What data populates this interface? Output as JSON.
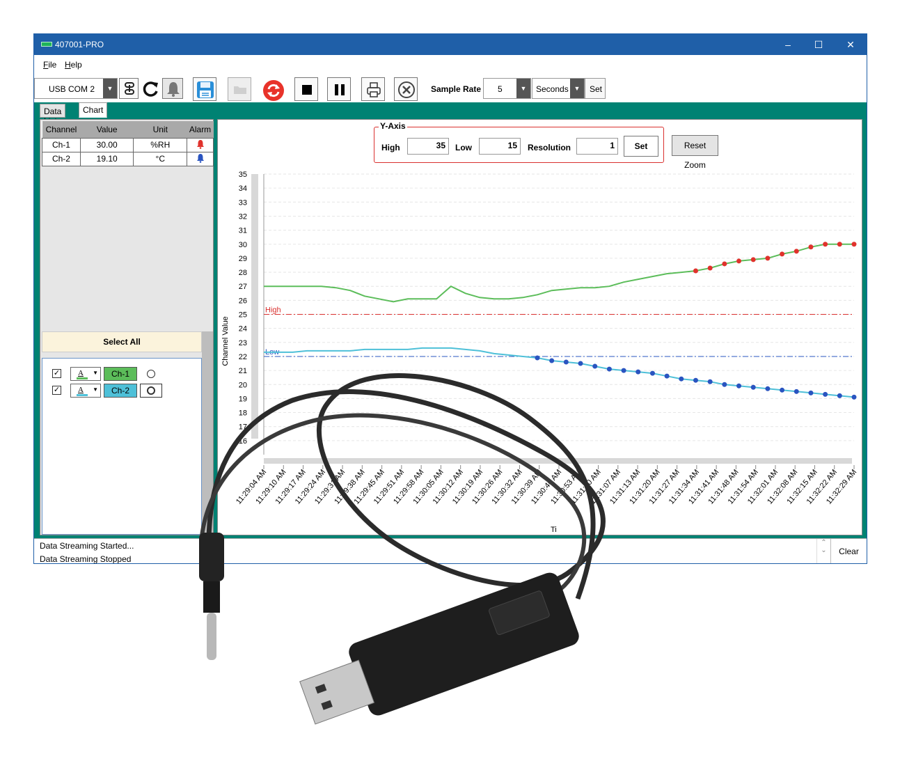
{
  "window": {
    "title": "407001-PRO",
    "minimize": "–",
    "maximize": "☐",
    "close": "✕"
  },
  "menu": {
    "file": "File",
    "help": "Help"
  },
  "toolbar": {
    "port": "USB COM 2",
    "sample_rate_label": "Sample Rate",
    "sample_rate_value": "5",
    "sample_rate_unit": "Seconds",
    "set_label": "Set"
  },
  "tabs": {
    "data_list": "Data List",
    "chart": "Chart"
  },
  "grid": {
    "headers": [
      "Channel",
      "Value",
      "Unit",
      "Alarm"
    ],
    "rows": [
      {
        "channel": "Ch-1",
        "value": "30.00",
        "unit": "%RH",
        "alarm_color": "#e0322c"
      },
      {
        "channel": "Ch-2",
        "value": "19.10",
        "unit": "°C",
        "alarm_color": "#2a54c0"
      }
    ]
  },
  "channels": {
    "select_all": "Select All",
    "items": [
      {
        "name": "Ch-1",
        "color": "#5cbd5a",
        "checked": true,
        "color_btn": "A"
      },
      {
        "name": "Ch-2",
        "color": "#4ec0d8",
        "checked": true,
        "color_btn": "A"
      }
    ]
  },
  "y_axis": {
    "legend": "Y-Axis",
    "high_label": "High",
    "high_value": "35",
    "low_label": "Low",
    "low_value": "15",
    "resolution_label": "Resolution",
    "resolution_value": "1",
    "set_label": "Set",
    "reset_zoom": "Reset Zoom"
  },
  "chart_data": {
    "type": "line",
    "ylabel": "Channel Value",
    "xlabel": "Ti",
    "ylim": [
      15,
      35
    ],
    "y_ticks": [
      16,
      17,
      18,
      19,
      20,
      21,
      22,
      23,
      24,
      25,
      26,
      27,
      28,
      29,
      30,
      31,
      32,
      33,
      34,
      35
    ],
    "high_line": {
      "label": "High",
      "value": 25,
      "color": "#d9302e"
    },
    "low_line": {
      "label": "Low",
      "value": 22,
      "color": "#2a54c0"
    },
    "categories": [
      "11:29:04 AM",
      "11:29:10 AM",
      "11:29:17 AM",
      "11:29:24 AM",
      "11:29:31 AM",
      "11:29:38 AM",
      "11:29:45 AM",
      "11:29:51 AM",
      "11:29:58 AM",
      "11:30:05 AM",
      "11:30:12 AM",
      "11:30:19 AM",
      "11:30:26 AM",
      "11:30:32 AM",
      "11:30:39 AM",
      "11:30:46 AM",
      "11:30:53 AM",
      "11:31:00 AM",
      "11:31:07 AM",
      "11:31:13 AM",
      "11:31:20 AM",
      "11:31:27 AM",
      "11:31:34 AM",
      "11:31:41 AM",
      "11:31:48 AM",
      "11:31:54 AM",
      "11:32:01 AM",
      "11:32:08 AM",
      "11:32:15 AM",
      "11:32:22 AM",
      "11:32:29 AM"
    ],
    "series": [
      {
        "name": "Ch-1",
        "color": "#5cbd5a",
        "alarm_marker_color": "#e0322c",
        "x": [
          0,
          1,
          2,
          3,
          4,
          5,
          6,
          7,
          8,
          9,
          10,
          11,
          12,
          13,
          14,
          15,
          16,
          17,
          18,
          19,
          20,
          21,
          22,
          23,
          24,
          25,
          26,
          27,
          28,
          29,
          30,
          31,
          32,
          33,
          34,
          35,
          36,
          37,
          38,
          39,
          40,
          41
        ],
        "values": [
          27.0,
          27.0,
          27.0,
          27.0,
          27.0,
          26.9,
          26.7,
          26.3,
          26.1,
          25.9,
          26.1,
          26.1,
          26.1,
          27.0,
          26.5,
          26.2,
          26.1,
          26.1,
          26.2,
          26.4,
          26.7,
          26.8,
          26.9,
          26.9,
          27.0,
          27.3,
          27.5,
          27.7,
          27.9,
          28.0,
          28.1,
          28.3,
          28.6,
          28.8,
          28.9,
          29.0,
          29.3,
          29.5,
          29.8,
          30.0,
          30.0,
          30.0
        ],
        "alarm_from_index": 30
      },
      {
        "name": "Ch-2",
        "color": "#4ec0d8",
        "alarm_marker_color": "#2a54c0",
        "x": [
          0,
          1,
          2,
          3,
          4,
          5,
          6,
          7,
          8,
          9,
          10,
          11,
          12,
          13,
          14,
          15,
          16,
          17,
          18,
          19,
          20,
          21,
          22,
          23,
          24,
          25,
          26,
          27,
          28,
          29,
          30,
          31,
          32,
          33,
          34,
          35,
          36,
          37,
          38,
          39,
          40,
          41
        ],
        "values": [
          22.3,
          22.3,
          22.3,
          22.4,
          22.4,
          22.4,
          22.4,
          22.5,
          22.5,
          22.5,
          22.5,
          22.6,
          22.6,
          22.6,
          22.5,
          22.4,
          22.2,
          22.1,
          22.0,
          21.9,
          21.7,
          21.6,
          21.5,
          21.3,
          21.1,
          21.0,
          20.9,
          20.8,
          20.6,
          20.4,
          20.3,
          20.2,
          20.0,
          19.9,
          19.8,
          19.7,
          19.6,
          19.5,
          19.4,
          19.3,
          19.2,
          19.1
        ],
        "alarm_from_index": 19
      }
    ]
  },
  "status": {
    "line1": "Data Streaming Started...",
    "line2": "Data Streaming Stopped",
    "clear": "Clear"
  }
}
